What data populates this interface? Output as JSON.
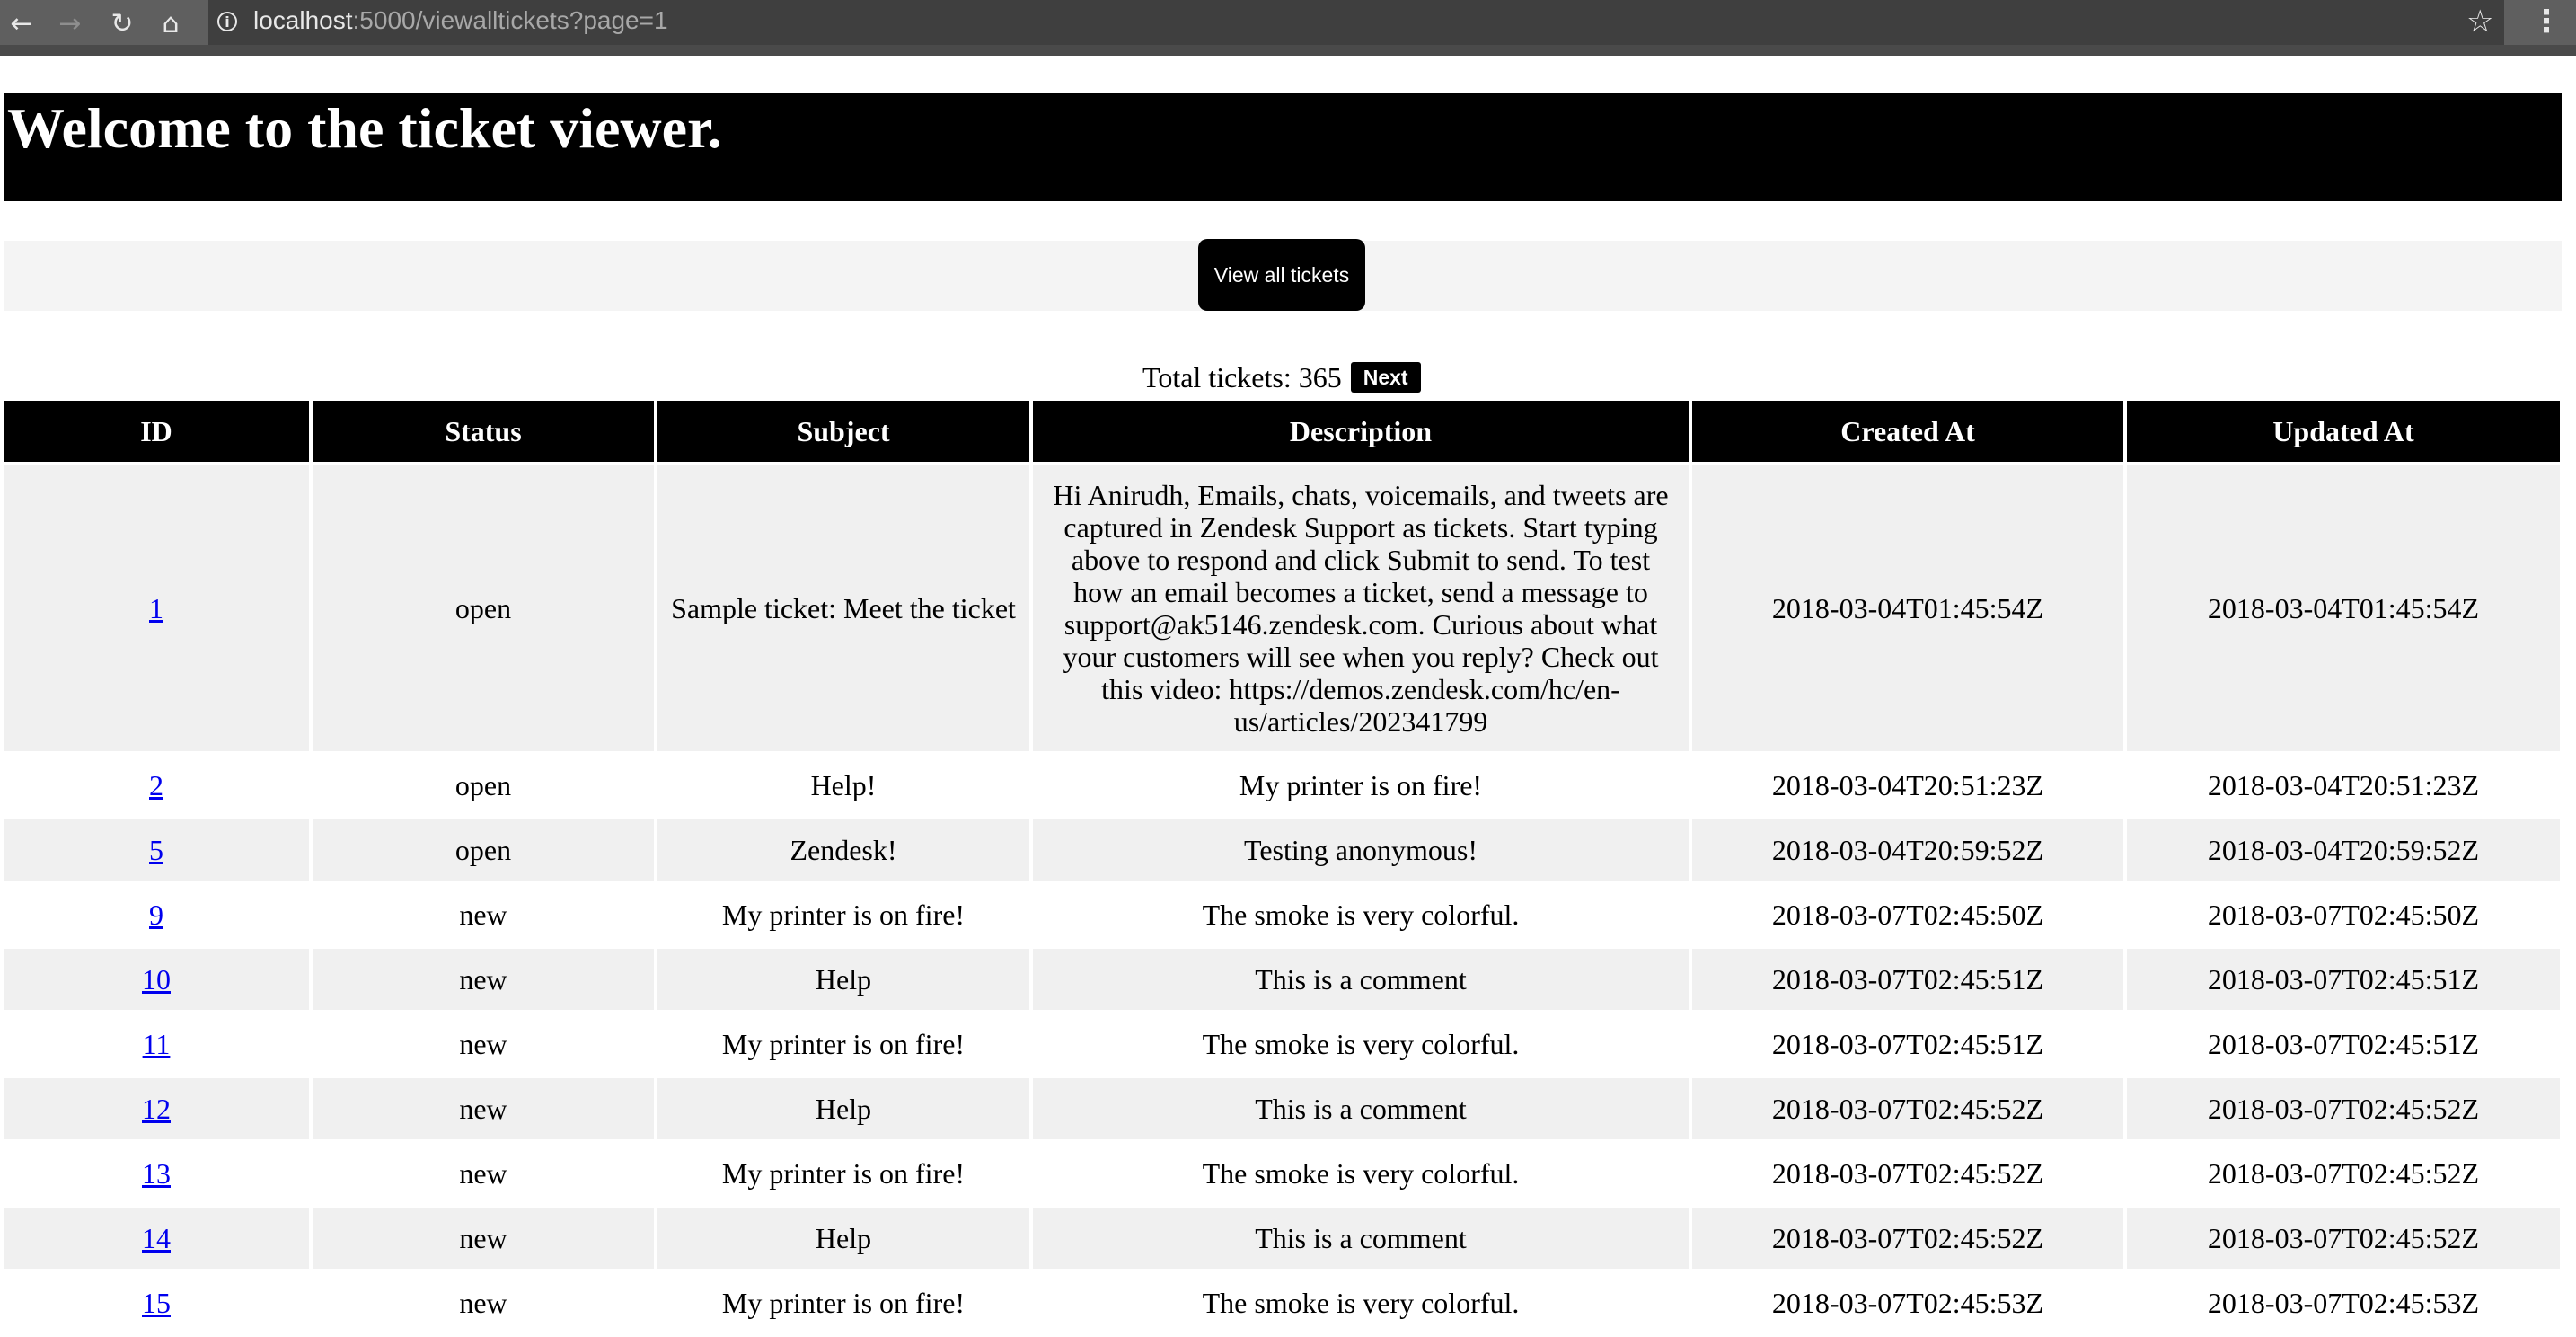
{
  "browser": {
    "url_host": "localhost",
    "url_rest": ":5000/viewalltickets?page=1"
  },
  "page": {
    "heading": "Welcome to the ticket viewer.",
    "view_all_label": "View all tickets",
    "total_label": "Total tickets: 365",
    "next_label": "Next"
  },
  "table": {
    "headers": [
      "ID",
      "Status",
      "Subject",
      "Description",
      "Created At",
      "Updated At"
    ],
    "rows": [
      {
        "id": "1",
        "status": "open",
        "subject": "Sample ticket: Meet the ticket",
        "description": "Hi Anirudh, Emails, chats, voicemails, and tweets are captured in Zendesk Support as tickets. Start typing above to respond and click Submit to send. To test how an email becomes a ticket, send a message to support@ak5146.zendesk.com. Curious about what your customers will see when you reply? Check out this video: https://demos.zendesk.com/hc/en-us/articles/202341799",
        "created": "2018-03-04T01:45:54Z",
        "updated": "2018-03-04T01:45:54Z"
      },
      {
        "id": "2",
        "status": "open",
        "subject": "Help!",
        "description": "My printer is on fire!",
        "created": "2018-03-04T20:51:23Z",
        "updated": "2018-03-04T20:51:23Z"
      },
      {
        "id": "5",
        "status": "open",
        "subject": "Zendesk!",
        "description": "Testing anonymous!",
        "created": "2018-03-04T20:59:52Z",
        "updated": "2018-03-04T20:59:52Z"
      },
      {
        "id": "9",
        "status": "new",
        "subject": "My printer is on fire!",
        "description": "The smoke is very colorful.",
        "created": "2018-03-07T02:45:50Z",
        "updated": "2018-03-07T02:45:50Z"
      },
      {
        "id": "10",
        "status": "new",
        "subject": "Help",
        "description": "This is a comment",
        "created": "2018-03-07T02:45:51Z",
        "updated": "2018-03-07T02:45:51Z"
      },
      {
        "id": "11",
        "status": "new",
        "subject": "My printer is on fire!",
        "description": "The smoke is very colorful.",
        "created": "2018-03-07T02:45:51Z",
        "updated": "2018-03-07T02:45:51Z"
      },
      {
        "id": "12",
        "status": "new",
        "subject": "Help",
        "description": "This is a comment",
        "created": "2018-03-07T02:45:52Z",
        "updated": "2018-03-07T02:45:52Z"
      },
      {
        "id": "13",
        "status": "new",
        "subject": "My printer is on fire!",
        "description": "The smoke is very colorful.",
        "created": "2018-03-07T02:45:52Z",
        "updated": "2018-03-07T02:45:52Z"
      },
      {
        "id": "14",
        "status": "new",
        "subject": "Help",
        "description": "This is a comment",
        "created": "2018-03-07T02:45:52Z",
        "updated": "2018-03-07T02:45:52Z"
      },
      {
        "id": "15",
        "status": "new",
        "subject": "My printer is on fire!",
        "description": "The smoke is very colorful.",
        "created": "2018-03-07T02:45:53Z",
        "updated": "2018-03-07T02:45:53Z"
      }
    ]
  }
}
